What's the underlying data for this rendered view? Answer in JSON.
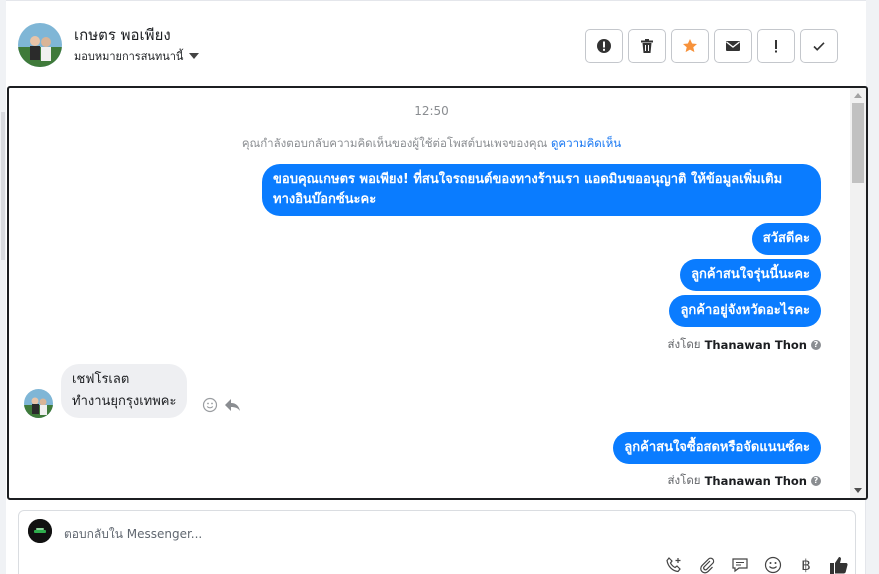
{
  "contact": {
    "name": "เกษตร พอเพียง",
    "assign_label": "มอบหมายการสนทนานี้"
  },
  "toolbar": {
    "buttons": [
      {
        "icon": "alert-circle-icon"
      },
      {
        "icon": "trash-icon"
      },
      {
        "icon": "star-icon",
        "color": "#f7923b"
      },
      {
        "icon": "envelope-icon"
      },
      {
        "icon": "exclamation-icon"
      },
      {
        "icon": "checkmark-icon"
      }
    ]
  },
  "thread": {
    "time": "12:50",
    "notice_text": "คุณกำลังตอบกลับความคิดเห็นของผู้ใช้ต่อโพสต์บนเพจของคุณ",
    "notice_link": "ดูความคิดเห็น",
    "outgoing_1": {
      "line1": "ขอบคุณเกษตร พอเพียง! ที่สนใจรถยนต์ของทางร้านเรา แอดมินขออนุญาติ ให้ข้อมูลเพิ่มเติม",
      "line2": "ทางอินบ๊อกซ์นะคะ"
    },
    "outgoing_2": "สวัสดีคะ",
    "outgoing_3": "ลูกค้าสนใจรุ่นนี้นะคะ",
    "outgoing_4": "ลูกค้าอยู่จังหวัดอะไรคะ",
    "sent_by_1": {
      "prefix": "ส่งโดย",
      "name": "Thanawan Thon"
    },
    "incoming_1": {
      "line1": "เชฟโรเลต",
      "line2": "ทำงานยุกรุงเทพคะ"
    },
    "outgoing_5": "ลูกค้าสนใจซื้อสดหรือจัดแนนซ์คะ",
    "sent_by_2": {
      "prefix": "ส่งโดย",
      "name": "Thanawan Thon"
    }
  },
  "composer": {
    "placeholder": "ตอบกลับใน Messenger...",
    "icons": [
      "phone-add-icon",
      "paperclip-icon",
      "saved-reply-icon",
      "emoji-icon",
      "baht-icon",
      "thumbs-up-icon"
    ]
  },
  "colors": {
    "accent": "#0a7cff",
    "link": "#1877f2",
    "incoming_bg": "#eeeff2"
  }
}
